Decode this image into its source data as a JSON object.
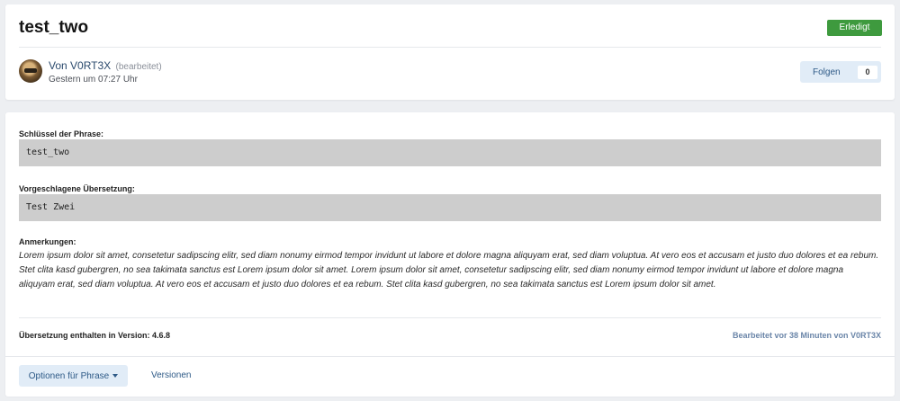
{
  "header": {
    "title": "test_two",
    "status": "Erledigt",
    "author_prefix": "Von",
    "author": "V0RT3X",
    "edited": "(bearbeitet)",
    "date": "Gestern um 07:27 Uhr",
    "follow_label": "Folgen",
    "follow_count": "0"
  },
  "content": {
    "key_label": "Schlüssel der Phrase:",
    "key_value": "test_two",
    "translation_label": "Vorgeschlagene Übersetzung:",
    "translation_value": "Test Zwei",
    "notes_label": "Anmerkungen:",
    "notes_text": "Lorem ipsum dolor sit amet, consetetur sadipscing elitr, sed diam nonumy eirmod tempor invidunt ut labore et dolore magna aliquyam erat, sed diam voluptua. At vero eos et accusam et justo duo dolores et ea rebum. Stet clita kasd gubergren, no sea takimata sanctus est Lorem ipsum dolor sit amet. Lorem ipsum dolor sit amet, consetetur sadipscing elitr, sed diam nonumy eirmod tempor invidunt ut labore et dolore magna aliquyam erat, sed diam voluptua. At vero eos et accusam et justo duo dolores et ea rebum. Stet clita kasd gubergren, no sea takimata sanctus est Lorem ipsum dolor sit amet.",
    "version_label": "Übersetzung enthalten in Version: 4.6.8",
    "edit_info": "Bearbeitet vor 38 Minuten von V0RT3X"
  },
  "footer": {
    "options_label": "Optionen für Phrase",
    "versions_label": "Versionen"
  },
  "colors": {
    "status": "#3e9a3e",
    "accent": "#2e5a87",
    "field_bg": "#cdcdcd"
  }
}
